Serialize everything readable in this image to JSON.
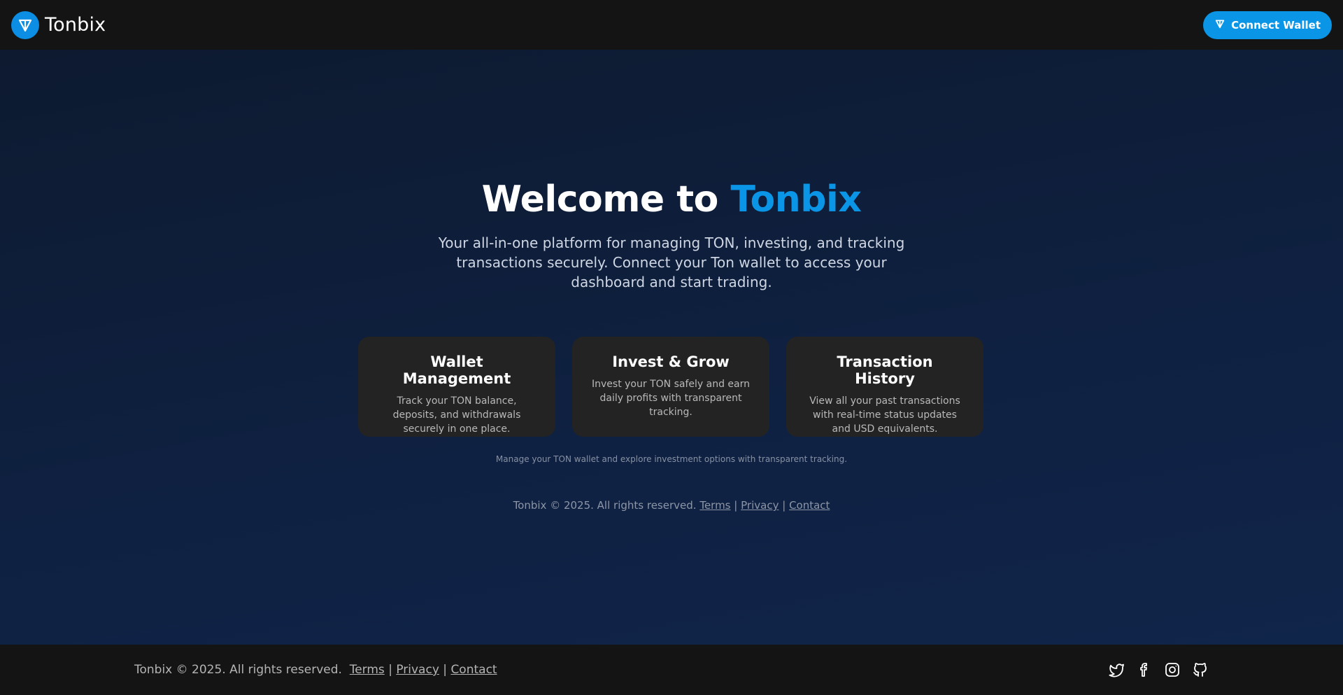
{
  "navbar": {
    "brand_name": "Tonbix",
    "logo_icon": "ton-diamond-icon",
    "connect_button_label": "Connect Wallet"
  },
  "hero": {
    "title_prefix": "Welcome to ",
    "title_accent": "Tonbix",
    "subtitle": "Your all-in-one platform for managing TON, investing, and tracking transactions securely. Connect your Ton wallet to access your dashboard and start trading."
  },
  "features": [
    {
      "title": "Wallet Management",
      "description": "Track your TON balance, deposits, and withdrawals securely in one place."
    },
    {
      "title": "Invest & Grow",
      "description": "Invest your TON safely and earn daily profits with transparent tracking."
    },
    {
      "title": "Transaction History",
      "description": "View all your past transactions with real-time status updates and USD equivalents."
    }
  ],
  "tagline": "Manage your TON wallet and explore investment options with transparent tracking.",
  "inner_footer": {
    "copyright": "Tonbix © 2025. All rights reserved.",
    "terms": "Terms",
    "privacy": "Privacy",
    "contact": "Contact",
    "separator": "|"
  },
  "footer": {
    "copyright": "Tonbix © 2025. All rights reserved.",
    "terms": "Terms",
    "privacy": "Privacy",
    "contact": "Contact",
    "separator": "|",
    "social_icons": [
      "twitter-icon",
      "facebook-icon",
      "instagram-icon",
      "github-icon"
    ]
  },
  "colors": {
    "accent": "#0b95e6",
    "navbar_bg": "#141414",
    "card_bg": "#232323",
    "main_bg": "#0f2142"
  }
}
